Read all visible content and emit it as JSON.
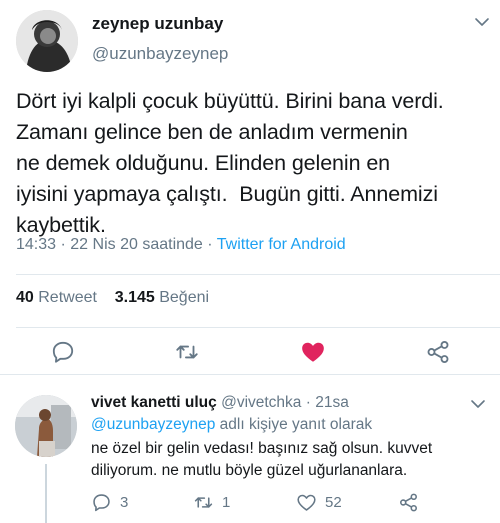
{
  "tweet": {
    "author_name": "zeynep uzunbay",
    "author_handle": "@uzunbayzeynep",
    "text": "Dört iyi kalpli çocuk büyüttü. Birini bana verdi.\nZamanı gelince ben de anladım vermenin\nne demek olduğunu. Elinden gelenin en\niyisini yapmaya çalıştı.  Bugün gitti. Annemizi\nkaybettik.",
    "time": "14:33",
    "date": "22 Nis 20 saatinde",
    "source": "Twitter for Android",
    "retweet_count": "40",
    "retweet_label": "Retweet",
    "like_count": "3.145",
    "like_label": "Beğeni",
    "like_color": "#e0245e"
  },
  "reply": {
    "author_name": "vivet kanetti uluç",
    "author_handle": "@vivetchka",
    "time": "21sa",
    "reply_to_handle": "@uzunbayzeynep",
    "reply_to_suffix": "adlı kişiye yanıt olarak",
    "text": "ne özel bir gelin vedası! başınız sağ olsun. kuvvet diliyorum. ne mutlu böyle güzel uğurlananlara.",
    "reply_count": "3",
    "retweet_count": "1",
    "like_count": "52"
  },
  "colors": {
    "text": "#14171a",
    "secondary": "#657786",
    "link": "#1da1f2",
    "divider": "#e1e8ed"
  }
}
